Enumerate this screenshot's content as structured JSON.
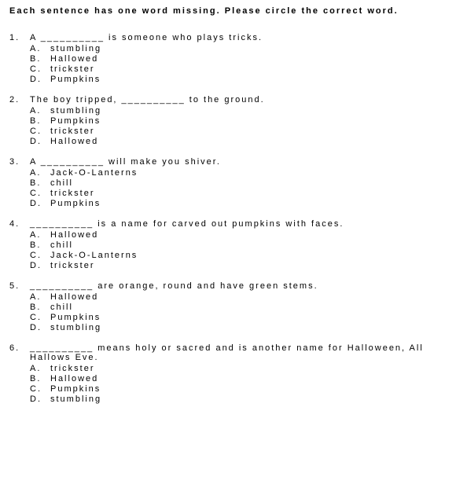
{
  "instructions": "Each sentence has one word missing.  Please circle the correct word.",
  "questions": [
    {
      "num": "1.",
      "stem": "A  __________  is someone who plays tricks.",
      "opts": [
        {
          "l": "A.",
          "t": " stumbling"
        },
        {
          "l": "B.",
          "t": "Hallowed"
        },
        {
          "l": "C.",
          "t": "trickster"
        },
        {
          "l": "D.",
          "t": "Pumpkins"
        }
      ]
    },
    {
      "num": "2.",
      "stem": "The boy tripped,  __________  to the ground.",
      "opts": [
        {
          "l": "A.",
          "t": "stumbling"
        },
        {
          "l": "B.",
          "t": "Pumpkins"
        },
        {
          "l": "C.",
          "t": "trickster"
        },
        {
          "l": "D.",
          "t": "Hallowed"
        }
      ]
    },
    {
      "num": "3.",
      "stem": "A  __________  will make you shiver.",
      "opts": [
        {
          "l": "A.",
          "t": "Jack-O-Lanterns"
        },
        {
          "l": "B.",
          "t": "chill"
        },
        {
          "l": "C.",
          "t": "trickster"
        },
        {
          "l": "D.",
          "t": "Pumpkins"
        }
      ]
    },
    {
      "num": "4.",
      "stem": " __________  is a name for carved out pumpkins with faces.",
      "opts": [
        {
          "l": "A.",
          "t": "Hallowed"
        },
        {
          "l": "B.",
          "t": "chill"
        },
        {
          "l": "C.",
          "t": "Jack-O-Lanterns"
        },
        {
          "l": "D.",
          "t": "trickster"
        }
      ]
    },
    {
      "num": "5.",
      "stem": " __________  are orange, round and have green stems.",
      "opts": [
        {
          "l": "A.",
          "t": "Hallowed"
        },
        {
          "l": "B.",
          "t": "chill"
        },
        {
          "l": "C.",
          "t": "Pumpkins"
        },
        {
          "l": "D.",
          "t": "stumbling"
        }
      ]
    },
    {
      "num": "6.",
      "stem": " __________  means holy or sacred and is another name for Halloween, All Hallows Eve.",
      "opts": [
        {
          "l": "A.",
          "t": "trickster"
        },
        {
          "l": "B.",
          "t": "Hallowed"
        },
        {
          "l": "C.",
          "t": "Pumpkins"
        },
        {
          "l": "D.",
          "t": "stumbling"
        }
      ]
    }
  ]
}
